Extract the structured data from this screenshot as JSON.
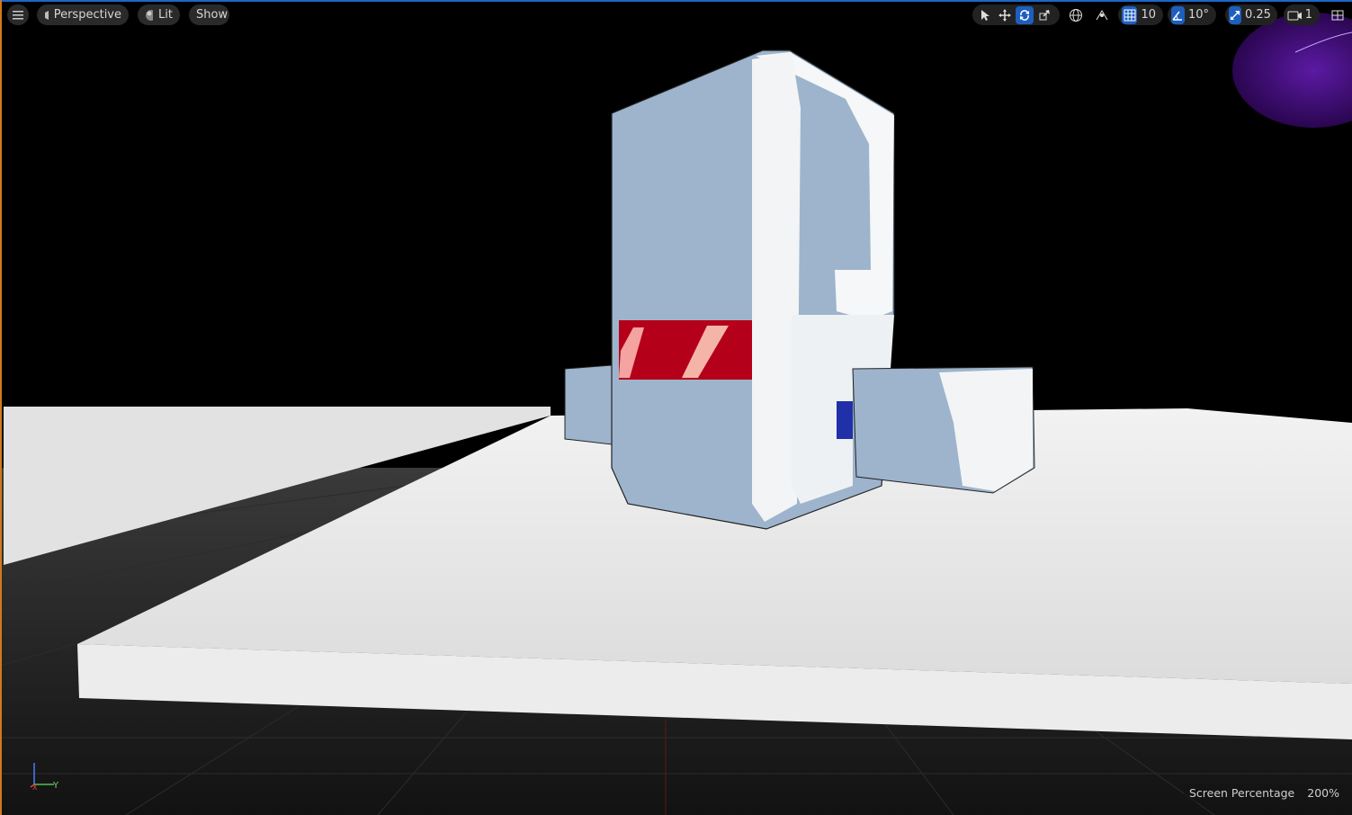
{
  "toolbar": {
    "view_mode": "Perspective",
    "lighting": "Lit",
    "show": "Show",
    "grid_snap": "10",
    "rotation_snap": "10°",
    "scale_snap": "0.25",
    "camera_speed": "1"
  },
  "axis": {
    "x": "X",
    "y": "Y",
    "z": "Z"
  },
  "status": {
    "label": "Screen Percentage",
    "value": "200%"
  },
  "colors": {
    "accent": "#1d5fbf",
    "toolbar_bg": "#2a2a2a",
    "selection_frame": "#d07a1a"
  }
}
